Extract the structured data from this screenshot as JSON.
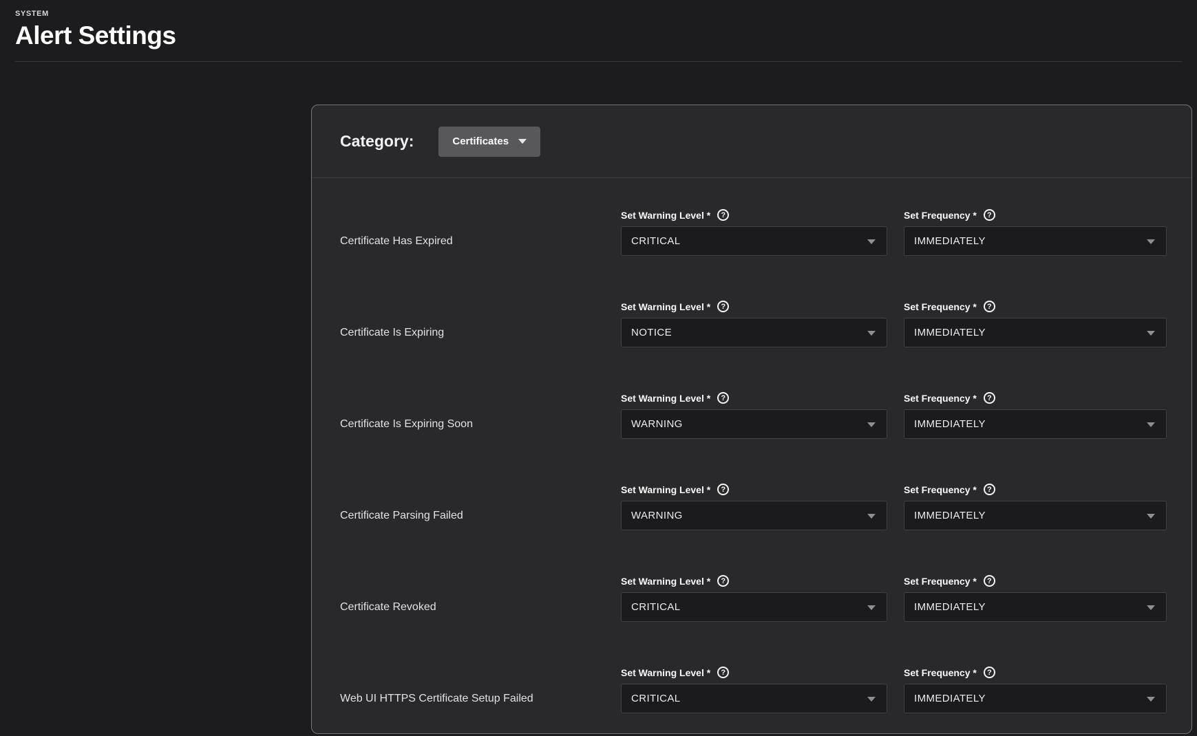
{
  "header": {
    "eyebrow": "SYSTEM",
    "title": "Alert Settings"
  },
  "panel": {
    "category_label": "Category:",
    "category_value": "Certificates",
    "field_labels": {
      "warning": "Set Warning Level *",
      "frequency": "Set Frequency *"
    },
    "rows": [
      {
        "name": "Certificate Has Expired",
        "warning_value": "CRITICAL",
        "frequency_value": "IMMEDIATELY"
      },
      {
        "name": "Certificate Is Expiring",
        "warning_value": "NOTICE",
        "frequency_value": "IMMEDIATELY"
      },
      {
        "name": "Certificate Is Expiring Soon",
        "warning_value": "WARNING",
        "frequency_value": "IMMEDIATELY"
      },
      {
        "name": "Certificate Parsing Failed",
        "warning_value": "WARNING",
        "frequency_value": "IMMEDIATELY"
      },
      {
        "name": "Certificate Revoked",
        "warning_value": "CRITICAL",
        "frequency_value": "IMMEDIATELY"
      },
      {
        "name": "Web UI HTTPS Certificate Setup Failed",
        "warning_value": "CRITICAL",
        "frequency_value": "IMMEDIATELY"
      }
    ]
  },
  "icons": {
    "help": "?",
    "chevron_down": "chevron-down"
  },
  "colors": {
    "page-bg": "#1c1c1e",
    "card-bg": "#29292b",
    "card-border": "#77777a",
    "divider": "#3a3a3c",
    "select-bg": "#1b1b1d",
    "select-border": "#414143",
    "select-text": "#ededed",
    "chevron": "#8f8f8f",
    "button-bg": "#58585b",
    "text-primary": "#ffffff",
    "text-secondary": "#e2e2e2"
  }
}
